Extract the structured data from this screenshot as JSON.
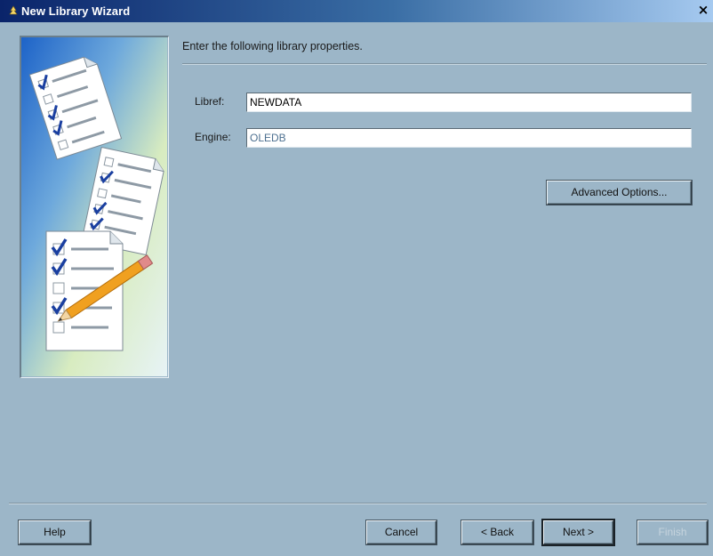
{
  "window": {
    "title": "New Library Wizard",
    "close_glyph": "×"
  },
  "main": {
    "instruction": "Enter the following library properties.",
    "libref": {
      "label": "Libref:",
      "value": "NEWDATA"
    },
    "engine": {
      "label": "Engine:",
      "value": "OLEDB"
    },
    "advanced_options_label": "Advanced Options..."
  },
  "footer": {
    "help_label": "Help",
    "cancel_label": "Cancel",
    "back_label": "< Back",
    "next_label": "Next >",
    "finish_label": "Finish"
  },
  "icons": {
    "app": "wizard-tree-icon",
    "side": "checklist-pencil-illustration"
  },
  "colors": {
    "dialog_background": "#9cb6c8",
    "titlebar_start": "#0a246a",
    "titlebar_end": "#a6caf0",
    "checkmark": "#1a3fa0",
    "pencil": "#f0a020"
  }
}
